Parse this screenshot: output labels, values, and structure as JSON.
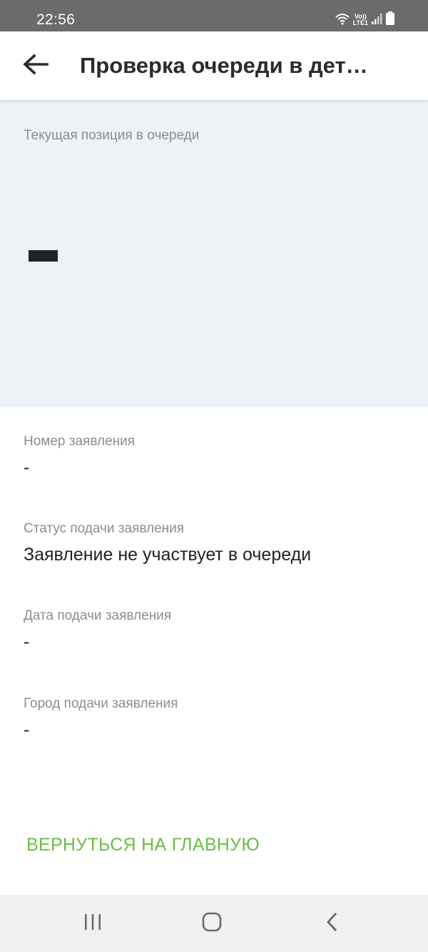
{
  "status_bar": {
    "time": "22:56",
    "network_line1": "Vo))",
    "network_line2": "LTE1",
    "icons": [
      "wifi-icon",
      "signal-icon",
      "battery-icon"
    ]
  },
  "header": {
    "title": "Проверка очереди в дет…",
    "back_icon": "arrow-left-icon"
  },
  "queue_position": {
    "label": "Текущая позиция в очереди"
  },
  "details": [
    {
      "label": "Номер заявления",
      "value": "-"
    },
    {
      "label": "Статус подачи заявления",
      "value": "Заявление не участвует в очереди"
    },
    {
      "label": "Дата подачи заявления",
      "value": "-"
    },
    {
      "label": "Город подачи заявления",
      "value": "-"
    }
  ],
  "actions": {
    "home_label": "ВЕРНУТЬСЯ НА ГЛАВНУЮ"
  },
  "nav_bar": {
    "icons": [
      "recent-apps-icon",
      "home-icon",
      "back-icon"
    ]
  },
  "colors": {
    "accent": "#6bbd45",
    "panel_bg": "#ecf2f6",
    "status_bar_bg": "#6b6b6b"
  }
}
